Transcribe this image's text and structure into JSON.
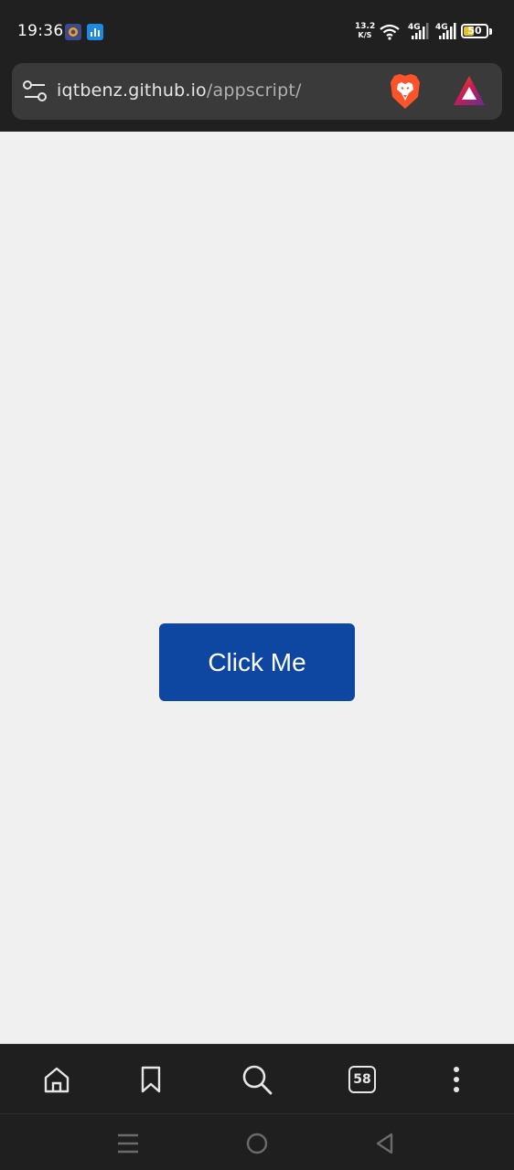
{
  "status_bar": {
    "time": "19:36",
    "net_speed_value": "13.2",
    "net_speed_unit": "K/S",
    "signal1_label": "4G",
    "signal2_label": "4G",
    "battery_percent": 50,
    "battery_label": "50",
    "battery_color": "#e8c22a"
  },
  "url_bar": {
    "domain": "iqtbenz.github.io",
    "path": "/appscript/",
    "site_settings_icon": "tune-icon",
    "brave_shields_icon": "brave-lion-icon",
    "rewards_icon": "brave-rewards-triangle-icon"
  },
  "page": {
    "button_label": "Click Me",
    "button_color": "#0d47a1",
    "background_color": "#f0f0f0"
  },
  "toolbar": {
    "tab_count": "58",
    "icons": [
      "home-icon",
      "bookmark-icon",
      "search-icon",
      "tabs-icon",
      "more-icon"
    ]
  },
  "navbar": {
    "icons": [
      "recents-icon",
      "home-circle-icon",
      "back-triangle-icon"
    ]
  }
}
